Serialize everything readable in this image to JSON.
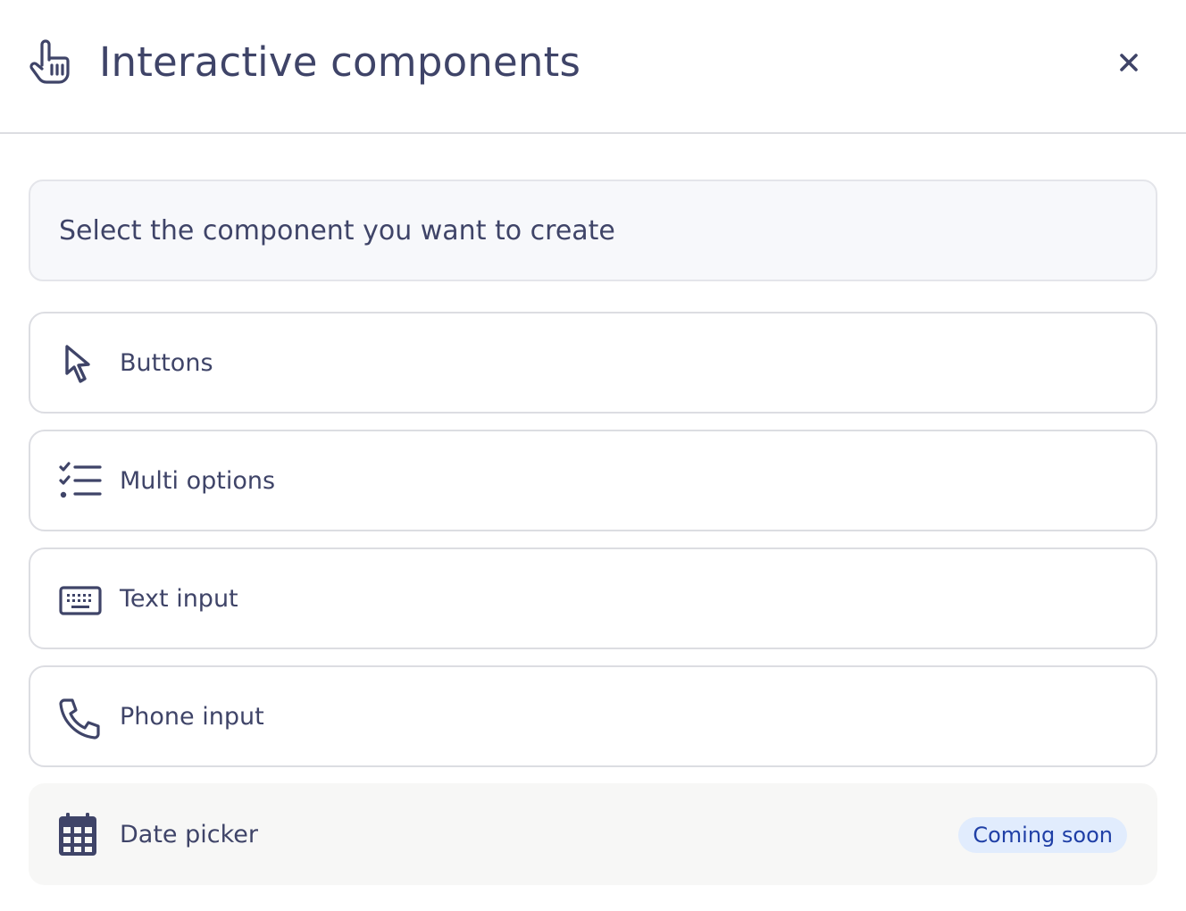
{
  "header": {
    "title": "Interactive components",
    "icon": "pointing-hand-icon",
    "close_icon": "close-icon"
  },
  "intro": {
    "text": "Select the component you want to create"
  },
  "options": [
    {
      "label": "Buttons",
      "icon": "cursor-arrow-icon"
    },
    {
      "label": "Multi options",
      "icon": "checklist-icon"
    },
    {
      "label": "Text input",
      "icon": "keyboard-icon"
    },
    {
      "label": "Phone input",
      "icon": "phone-icon"
    },
    {
      "label": "Date picker",
      "icon": "calendar-icon",
      "badge": "Coming soon"
    }
  ],
  "colors": {
    "text": "#3f4468",
    "border": "#dcdde2",
    "intro_background": "#f7f8fb",
    "disabled_background": "#f7f7f6",
    "badge_background": "#e1ecfd",
    "badge_text": "#1f3fa6"
  }
}
